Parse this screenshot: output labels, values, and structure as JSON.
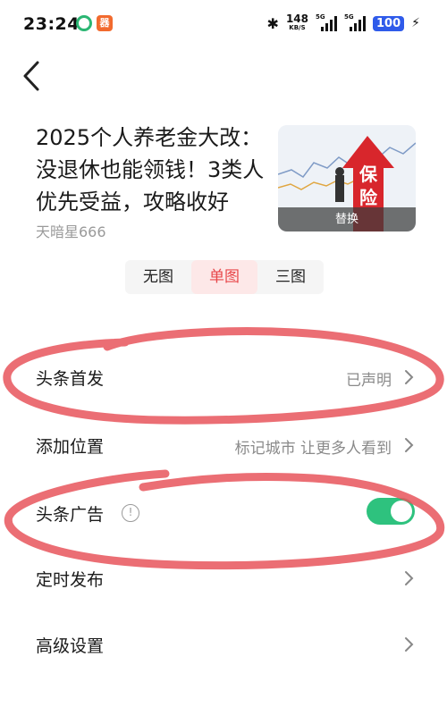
{
  "status_bar": {
    "time": "23:24",
    "app_icon_label": "器",
    "bluetooth_icon": "bluetooth-icon",
    "net_speed": "148",
    "net_unit": "KB/S",
    "signal1_tag": "5G",
    "signal2_tag": "5G",
    "battery": "100",
    "charging_icon": "bolt-icon"
  },
  "article": {
    "title": "2025个人养老金大改：没退休也能领钱！3类人优先受益，攻略收好",
    "author": "天暗星666",
    "cover_action": "替换",
    "cover_sign": "保险"
  },
  "image_mode": {
    "options": [
      "无图",
      "单图",
      "三图"
    ],
    "selected": "单图"
  },
  "settings": {
    "first_publish": {
      "label": "头条首发",
      "value": "已声明"
    },
    "location": {
      "label": "添加位置",
      "value": "标记城市 让更多人看到"
    },
    "ads": {
      "label": "头条广告",
      "info_glyph": "!",
      "enabled": true
    },
    "schedule": {
      "label": "定时发布"
    },
    "advanced": {
      "label": "高级设置"
    }
  },
  "colors": {
    "accent_red": "#e8474a",
    "toggle_green": "#2ec27e",
    "annotation_red": "#e8555c"
  }
}
